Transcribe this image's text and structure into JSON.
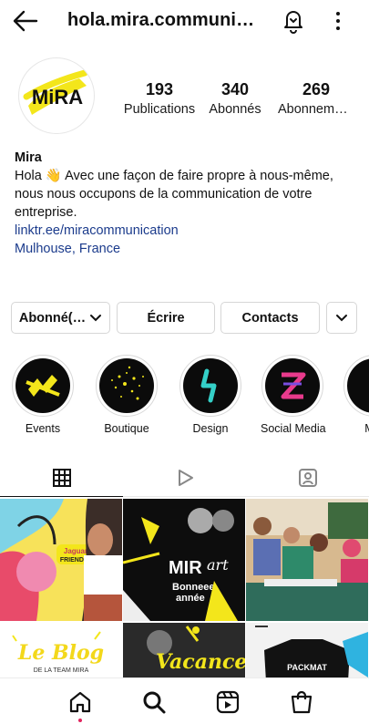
{
  "header": {
    "username": "hola.mira.communication",
    "back_icon": "arrow-left-icon",
    "bell_icon": "bell-icon",
    "more_icon": "more-vertical-icon"
  },
  "profile": {
    "avatar_text": "MiRA",
    "stats": [
      {
        "value": "193",
        "label": "Publications"
      },
      {
        "value": "340",
        "label": "Abonnés"
      },
      {
        "value": "269",
        "label": "Abonnements"
      }
    ],
    "name": "Mira",
    "bio_lines": [
      "Hola 👋 Avec une façon de faire propre à nous-même,",
      "nous nous occupons de la communication de votre",
      "entreprise."
    ],
    "link": "linktr.ee/miracommunication",
    "location": "Mulhouse, France"
  },
  "buttons": {
    "following": "Abonné(…",
    "message": "Écrire",
    "contacts": "Contacts",
    "chevron_icon": "chevron-down-icon"
  },
  "highlights": [
    {
      "label": "Events"
    },
    {
      "label": "Boutique"
    },
    {
      "label": "Design"
    },
    {
      "label": "Social Media"
    },
    {
      "label": "Mar"
    }
  ],
  "tabs": [
    {
      "icon": "grid-icon",
      "active": true
    },
    {
      "icon": "reels-icon",
      "active": false
    },
    {
      "icon": "tagged-icon",
      "active": false
    }
  ],
  "posts": {
    "post1_text": [
      "Jaguar",
      "FRIENDLY"
    ],
    "post2_text": [
      "MIR",
      "art",
      "Bonneee",
      "année"
    ],
    "post4_text": [
      "Le Blog",
      "DE LA TEAM MIRA"
    ],
    "post5_text": "Vacances",
    "post6_text": "PACKMAT"
  },
  "bottom_nav": [
    "home-icon",
    "search-icon",
    "reels-icon",
    "shop-icon"
  ],
  "colors": {
    "accent_yellow": "#f3e61b",
    "link_blue": "#1b3b8c",
    "notification_dot": "#e0245e"
  }
}
